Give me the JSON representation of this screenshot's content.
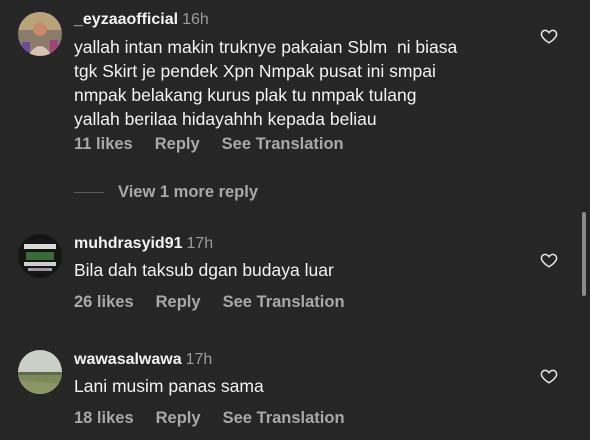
{
  "comments": [
    {
      "username": "_eyzaaofficial",
      "time": "16h",
      "text": "yallah intan makin truknye pakaian Sblm  ni biasa\ntgk Skirt je pendek Xpn Nmpak pusat ini smpai\nnmpak belakang kurus plak tu nmpak tulang\nyallah berilaa hidayahhh kepada beliau",
      "likes": "11 likes",
      "reply": "Reply",
      "translation": "See Translation"
    },
    {
      "username": "muhdrasyid91",
      "time": "17h",
      "text": "Bila dah taksub dgan budaya luar",
      "likes": "26 likes",
      "reply": "Reply",
      "translation": "See Translation"
    },
    {
      "username": "wawasalwawa",
      "time": "17h",
      "text": "Lani musim panas sama",
      "likes": "18 likes",
      "reply": "Reply",
      "translation": "See Translation"
    }
  ],
  "view_more": "View 1 more reply",
  "icons": {
    "like": "heart-outline-icon"
  },
  "colors": {
    "background": "#262626",
    "text": "#f2f2f2",
    "secondary": "#a8a8a8"
  }
}
